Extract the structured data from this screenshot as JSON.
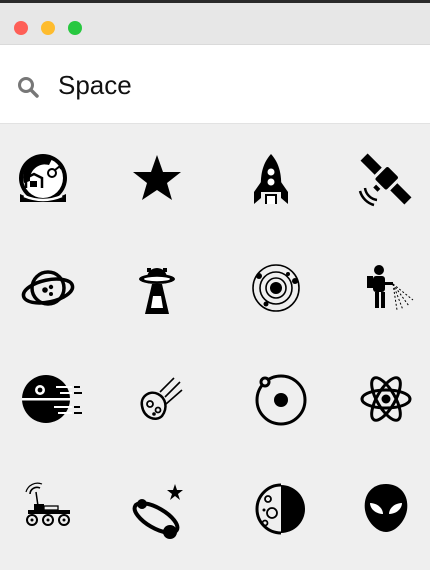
{
  "window": {
    "traffic_lights": [
      {
        "name": "close",
        "color": "#fe5f57"
      },
      {
        "name": "minimize",
        "color": "#febc2e"
      },
      {
        "name": "zoom",
        "color": "#28c840"
      }
    ]
  },
  "search": {
    "icon": "search-icon",
    "value": "Space"
  },
  "icons": [
    {
      "name": "astronaut-helmet-icon"
    },
    {
      "name": "star-icon"
    },
    {
      "name": "rocket-icon"
    },
    {
      "name": "satellite-icon"
    },
    {
      "name": "planet-ring-icon"
    },
    {
      "name": "ufo-beam-icon"
    },
    {
      "name": "solar-system-icon"
    },
    {
      "name": "astronaut-spraying-icon"
    },
    {
      "name": "death-star-icon"
    },
    {
      "name": "meteor-icon"
    },
    {
      "name": "orbit-icon"
    },
    {
      "name": "atom-icon"
    },
    {
      "name": "lunar-rover-icon"
    },
    {
      "name": "shooting-star-orbit-icon"
    },
    {
      "name": "moon-phase-icon"
    },
    {
      "name": "alien-head-icon"
    }
  ]
}
